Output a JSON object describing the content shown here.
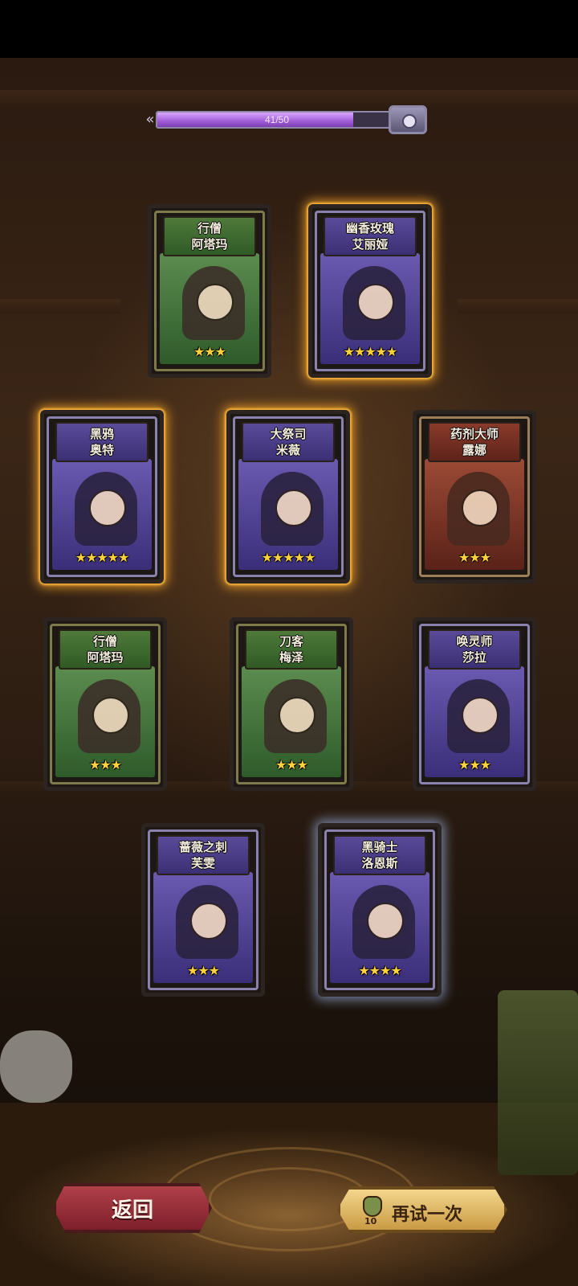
{
  "progress": {
    "text": "41/50",
    "value": 41,
    "max": 50,
    "fraction": 0.82
  },
  "cards": [
    {
      "name1": "行僧",
      "name2": "阿塔玛",
      "stars": "★★★",
      "rarity": "green",
      "glow": "none"
    },
    {
      "name1": "幽香玫瑰",
      "name2": "艾丽娅",
      "stars": "★★★★★",
      "rarity": "purple",
      "glow": "gold"
    },
    {
      "name1": "黑鸦",
      "name2": "奥特",
      "stars": "★★★★★",
      "rarity": "purple",
      "glow": "gold"
    },
    {
      "name1": "大祭司",
      "name2": "米薇",
      "stars": "★★★★★",
      "rarity": "purple",
      "glow": "gold"
    },
    {
      "name1": "药剂大师",
      "name2": "露娜",
      "stars": "★★★",
      "rarity": "red",
      "glow": "none"
    },
    {
      "name1": "行僧",
      "name2": "阿塔玛",
      "stars": "★★★",
      "rarity": "green",
      "glow": "none"
    },
    {
      "name1": "刀客",
      "name2": "梅泽",
      "stars": "★★★",
      "rarity": "green",
      "glow": "none"
    },
    {
      "name1": "唤灵师",
      "name2": "莎拉",
      "stars": "★★★",
      "rarity": "purple",
      "glow": "none"
    },
    {
      "name1": "蔷薇之刺",
      "name2": "芙雯",
      "stars": "★★★",
      "rarity": "purple",
      "glow": "none"
    },
    {
      "name1": "黑骑士",
      "name2": "洛恩斯",
      "stars": "★★★★",
      "rarity": "purple",
      "glow": "blue"
    }
  ],
  "buttons": {
    "back_label": "返回",
    "retry_label": "再试一次",
    "retry_cost": "10"
  },
  "colors": {
    "glow_gold": "#ffaa28",
    "progress_fill": "#a05ed6",
    "back_button": "#7d1f2a",
    "retry_button": "#c99a44"
  }
}
